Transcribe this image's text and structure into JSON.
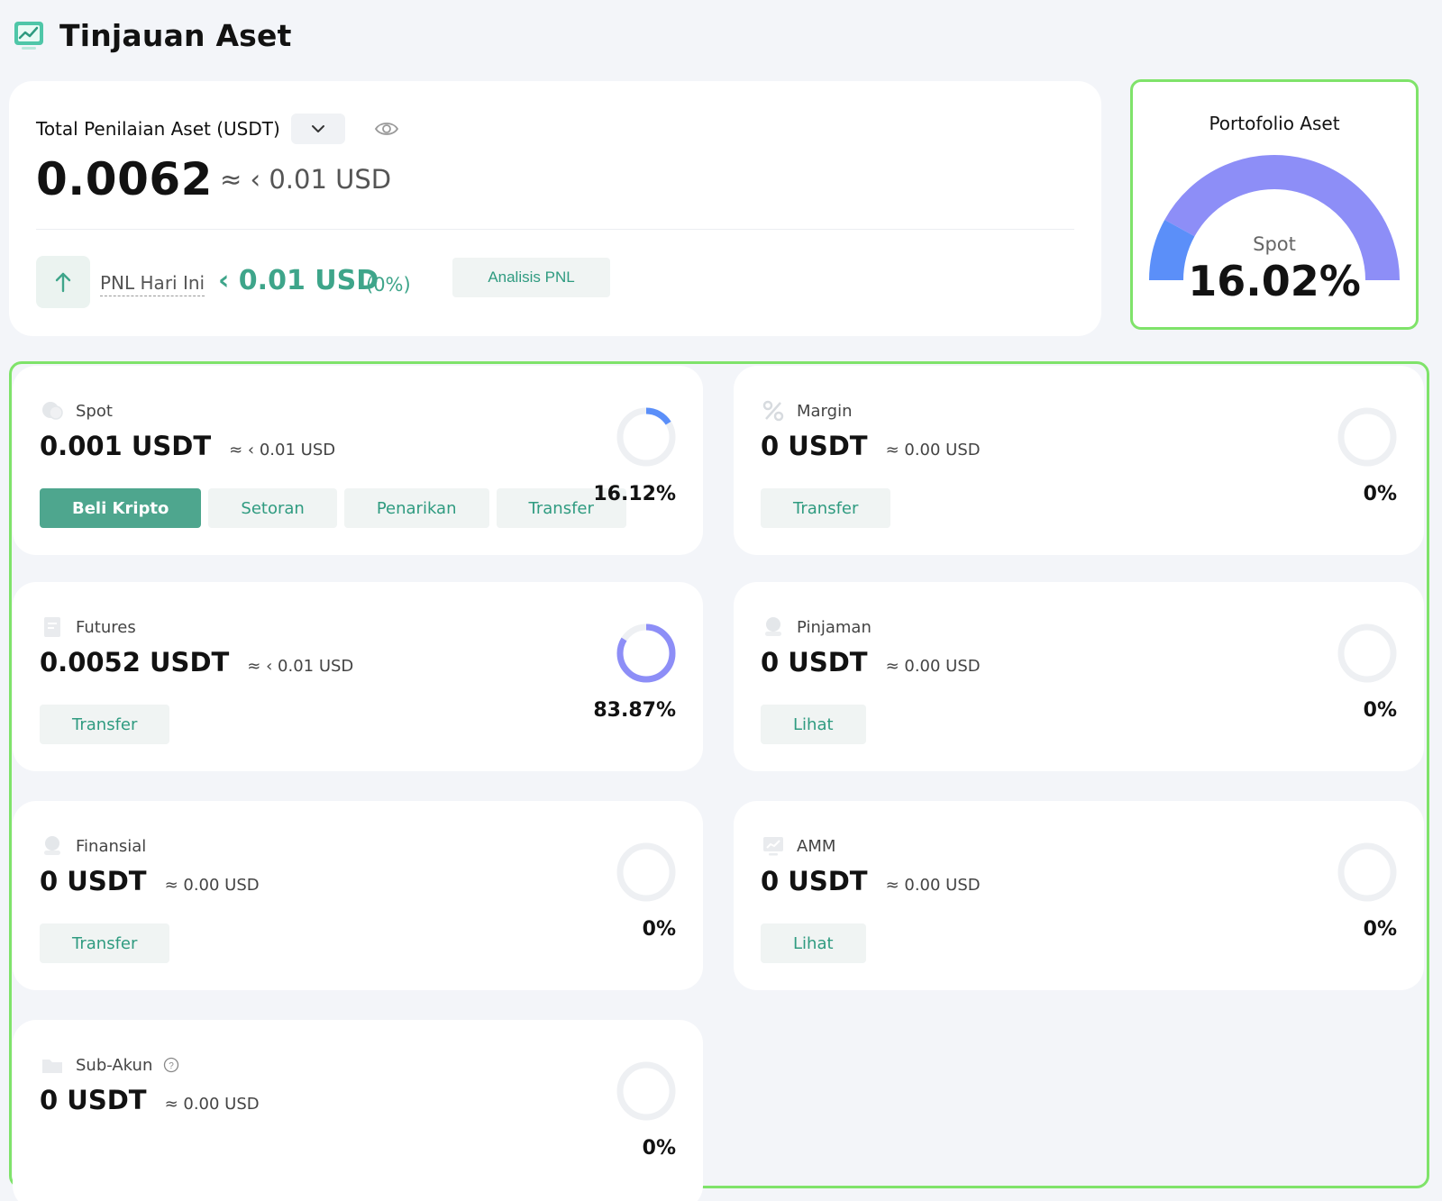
{
  "page": {
    "title": "Tinjauan Aset"
  },
  "total": {
    "label": "Total Penilaian Aset (USDT)",
    "value": "0.0062",
    "usd_approx": "≈ ‹ 0.01 USD",
    "pnl_label": "PNL Hari Ini",
    "pnl_value": "‹ 0.01 USD",
    "pnl_percent": "(0%)",
    "analysis_button": "Analisis PNL"
  },
  "portfolio": {
    "title": "Portofolio Aset",
    "segment_label": "Spot",
    "segment_value": "16.02%",
    "spot_fraction": 0.1602
  },
  "accounts": [
    {
      "name": "Spot",
      "value": "0.001 USDT",
      "usd": "≈ ‹ 0.01 USD",
      "percent": "16.12%",
      "fraction": 0.1612,
      "buttons": [
        "Beli Kripto",
        "Setoran",
        "Penarikan",
        "Transfer"
      ]
    },
    {
      "name": "Margin",
      "value": "0 USDT",
      "usd": "≈ 0.00 USD",
      "percent": "0%",
      "fraction": 0,
      "buttons": [
        "Transfer"
      ]
    },
    {
      "name": "Futures",
      "value": "0.0052 USDT",
      "usd": "≈ ‹ 0.01 USD",
      "percent": "83.87%",
      "fraction": 0.8387,
      "buttons": [
        "Transfer"
      ]
    },
    {
      "name": "Pinjaman",
      "value": "0 USDT",
      "usd": "≈ 0.00 USD",
      "percent": "0%",
      "fraction": 0,
      "buttons": [
        "Lihat"
      ]
    },
    {
      "name": "Finansial",
      "value": "0 USDT",
      "usd": "≈ 0.00 USD",
      "percent": "0%",
      "fraction": 0,
      "buttons": [
        "Transfer"
      ]
    },
    {
      "name": "AMM",
      "value": "0 USDT",
      "usd": "≈ 0.00 USD",
      "percent": "0%",
      "fraction": 0,
      "buttons": [
        "Lihat"
      ]
    },
    {
      "name": "Sub-Akun",
      "value": "0 USDT",
      "usd": "≈ 0.00 USD",
      "percent": "0%",
      "fraction": 0,
      "buttons": []
    }
  ],
  "icons": {
    "header": "chart-monitor-icon",
    "dropdown": "chevron-down-icon",
    "visibility": "eye-icon",
    "pnl": "arrow-up-icon",
    "help": "question-circle-icon"
  },
  "colors": {
    "accent_green": "#3ea58a",
    "primary_button": "#4ea68e",
    "highlight_border": "#7fe36a",
    "spot_blue": "#5b8ff9",
    "futures_purple": "#8d8ef7"
  }
}
